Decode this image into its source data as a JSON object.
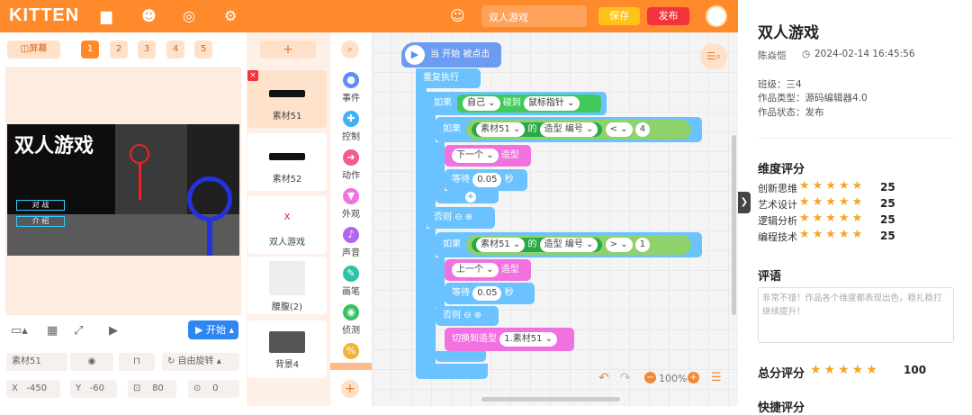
{
  "app": {
    "logo": "KITTEN",
    "project_name": "双人游戏",
    "save": "保存",
    "publish": "发布"
  },
  "stage": {
    "fullscreen": "屏幕",
    "scenes": [
      "1",
      "2",
      "3",
      "4",
      "5"
    ],
    "start": "开始",
    "title_art": "双人游戏",
    "menu_btn1": "对 战",
    "menu_btn2": "介 绍"
  },
  "props": {
    "name": "素材51",
    "rotate": "自由旋转",
    "x_label": "X",
    "x_val": "-450",
    "y_label": "Y",
    "y_val": "-60",
    "size": "80",
    "dir": "0"
  },
  "sprites": [
    {
      "label": "素材51"
    },
    {
      "label": "素材52"
    },
    {
      "label": "双人游戏"
    },
    {
      "label": "腰腹(2)"
    },
    {
      "label": "背景4"
    }
  ],
  "categories": [
    {
      "label": "事件",
      "color": "#5b8ff5"
    },
    {
      "label": "控制",
      "color": "#3fb1f7"
    },
    {
      "label": "动作",
      "color": "#f25a93"
    },
    {
      "label": "外观",
      "color": "#f171e0"
    },
    {
      "label": "声音",
      "color": "#b066f0"
    },
    {
      "label": "画笔",
      "color": "#2fc3a3"
    },
    {
      "label": "侦测",
      "color": "#36c263"
    },
    {
      "label": "运算",
      "color": "#f2b23d"
    }
  ],
  "code": {
    "hat": "当 开始 被点击",
    "forever": "重复执行",
    "if": "如果",
    "else": "否则",
    "self": "自己",
    "touch": "碰到",
    "mouse": "鼠标指针",
    "sprite": "素材51",
    "of": "的",
    "costume_num": "造型 编号",
    "lt": "<",
    "gt": ">",
    "n4": "4",
    "n1": "1",
    "next": "下一个",
    "prev": "上一个",
    "costume": "造型",
    "wait": "等待",
    "sec_val": "0.05",
    "sec": "秒",
    "switch": "切换到造型",
    "switch_val": "1.素材51",
    "zoom": "100%"
  },
  "right": {
    "title": "双人游戏",
    "author": "陈焱恺",
    "datetime": "2024-02-14 16:45:56",
    "grade": "班级：三4",
    "type": "作品类型：源码编辑器4.0",
    "status": "作品状态：发布",
    "dims_title": "维度评分",
    "dims": [
      {
        "name": "创新思维",
        "score": "25",
        "stars": 5
      },
      {
        "name": "艺术设计",
        "score": "25",
        "stars": 5
      },
      {
        "name": "逻辑分析",
        "score": "25",
        "stars": 5
      },
      {
        "name": "编程技术",
        "score": "25",
        "stars": 5
      }
    ],
    "comment_title": "评语",
    "comment": "非常不错！作品各个维度都表现出色，稳扎稳打继续提升！",
    "total_title": "总分评分",
    "total": "100",
    "total_stars": 5,
    "quick_title": "快捷评分"
  }
}
